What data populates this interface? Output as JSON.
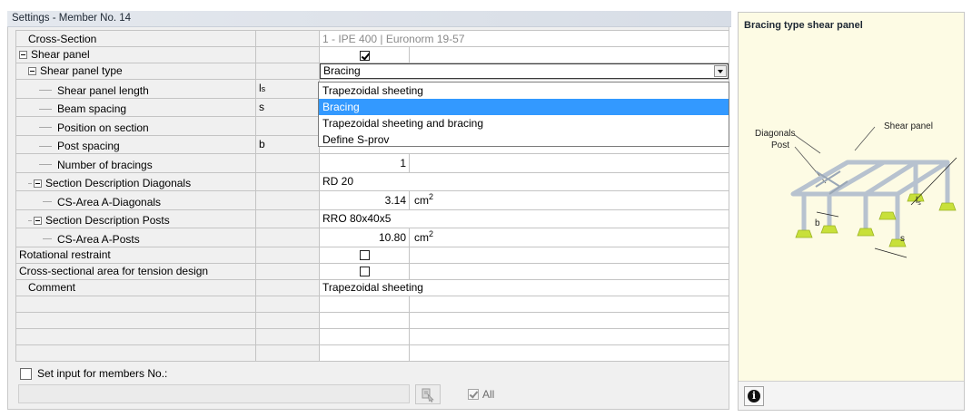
{
  "panel": {
    "title": "Settings - Member No. 14"
  },
  "rows": [
    {
      "label": "Cross-Section",
      "symbol": "",
      "value": "1 - IPE 400 | Euronorm 19-57",
      "unit": ""
    },
    {
      "label": "Shear panel",
      "symbol": "",
      "value": "",
      "unit": ""
    },
    {
      "label": "Shear panel type",
      "symbol": "",
      "value": "Bracing",
      "unit": ""
    },
    {
      "label": "Shear panel length",
      "symbol": "l",
      "symbol_sub": "s",
      "value": "Trapezoidal sheeting",
      "unit": ""
    },
    {
      "label": "Beam spacing",
      "symbol": "s",
      "value": "Bracing",
      "unit": ""
    },
    {
      "label": "Position on section",
      "symbol": "",
      "value": "Trapezoidal sheeting and bracing",
      "unit": ""
    },
    {
      "label": "Post spacing",
      "symbol": "b",
      "value": "Define S-prov",
      "unit": ""
    },
    {
      "label": "Number of bracings",
      "symbol": "",
      "value": "1",
      "unit": ""
    },
    {
      "label": "Section Description Diagonals",
      "symbol": "",
      "value": "RD 20",
      "unit": ""
    },
    {
      "label": "CS-Area  A-Diagonals",
      "symbol": "",
      "value": "3.14",
      "unit": "cm",
      "unit_sup": "2"
    },
    {
      "label": "Section Description Posts",
      "symbol": "",
      "value": "RRO 80x40x5",
      "unit": ""
    },
    {
      "label": "CS-Area  A-Posts",
      "symbol": "",
      "value": "10.80",
      "unit": "cm",
      "unit_sup": "2"
    },
    {
      "label": "Rotational restraint",
      "symbol": "",
      "value": "",
      "unit": ""
    },
    {
      "label": "Cross-sectional area for tension design",
      "symbol": "",
      "value": "",
      "unit": ""
    },
    {
      "label": "Comment",
      "symbol": "",
      "value": "Trapezoidal sheeting",
      "unit": ""
    }
  ],
  "checkboxes": {
    "shear_panel": true,
    "rotational_restraint": false,
    "tension_area": false
  },
  "dropdown": {
    "options": [
      "Trapezoidal sheeting",
      "Bracing",
      "Trapezoidal sheeting and bracing",
      "Define S-prov"
    ],
    "selected": "Bracing"
  },
  "footer": {
    "set_input_label": "Set input for members No.:",
    "set_input_checked": false,
    "members_value": "",
    "all_label": "All",
    "all_checked": true
  },
  "preview": {
    "title": "Bracing type shear panel",
    "labels": {
      "diagonals": "Diagonals",
      "post": "Post",
      "shear_panel": "Shear panel",
      "b": "b",
      "s": "s",
      "ls": "l",
      "ls_sub": "s"
    }
  },
  "colors": {
    "selection": "#3399ff",
    "support": "#c8e03a",
    "preview_bg": "#fdfbe4"
  }
}
